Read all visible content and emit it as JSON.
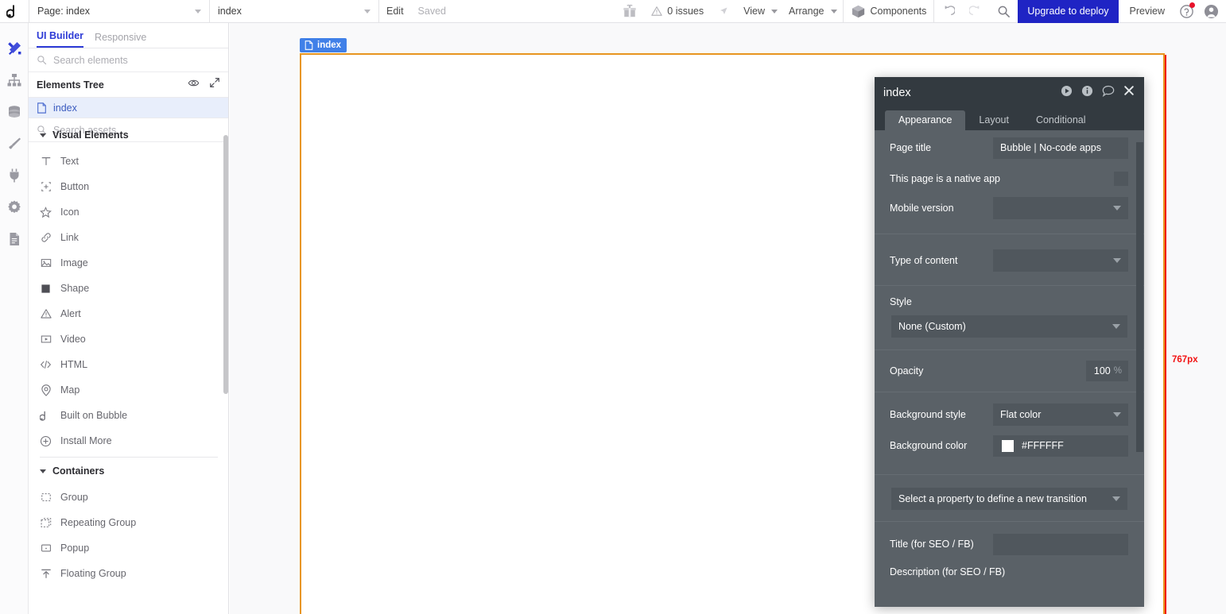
{
  "topbar": {
    "logo": "bubble-logo-icon",
    "page_selector": {
      "label": "Page: index",
      "icon": "chevron-down-icon"
    },
    "element_selector": {
      "label": "index",
      "icon": "chevron-down-icon"
    },
    "edit_label": "Edit",
    "saved_label": "Saved",
    "gift_icon": "gift-icon",
    "issues_label": "0 issues",
    "issues_icon": "warning-triangle-icon",
    "cursor_icon": "cursor-arrow-icon",
    "view_menu": "View",
    "arrange_menu": "Arrange",
    "components_label": "Components",
    "components_icon": "cube-icon",
    "undo_icon": "undo-icon",
    "redo_icon": "redo-icon",
    "search_icon": "search-icon",
    "upgrade_label": "Upgrade to deploy",
    "preview_label": "Preview",
    "help_icon": "question-circle-icon",
    "account_icon": "user-avatar-icon"
  },
  "rail": {
    "items": [
      {
        "name": "ui-builder",
        "icon": "design-tools-icon",
        "active": true
      },
      {
        "name": "workflow",
        "icon": "hierarchy-icon",
        "active": false
      },
      {
        "name": "data",
        "icon": "database-icon",
        "active": false
      },
      {
        "name": "styles",
        "icon": "paintbrush-icon",
        "active": false
      },
      {
        "name": "plugins",
        "icon": "plug-icon",
        "active": false
      },
      {
        "name": "settings",
        "icon": "gear-icon",
        "active": false
      },
      {
        "name": "logs",
        "icon": "document-icon",
        "active": false
      }
    ]
  },
  "left_panel": {
    "tabs": [
      {
        "label": "UI Builder",
        "active": true
      },
      {
        "label": "Responsive",
        "active": false
      }
    ],
    "search_elements_placeholder": "Search elements",
    "tree_header": {
      "title": "Elements Tree",
      "eye_icon": "eye-icon",
      "expand_icon": "expand-arrows-icon"
    },
    "tree_rows": [
      {
        "label": "index",
        "icon": "page-file-icon",
        "selected": true
      }
    ],
    "search_assets_placeholder": "Search assets",
    "sections": [
      {
        "title": "Visual Elements",
        "items": [
          {
            "label": "Text",
            "icon": "text-icon"
          },
          {
            "label": "Button",
            "icon": "button-icon"
          },
          {
            "label": "Icon",
            "icon": "star-icon"
          },
          {
            "label": "Link",
            "icon": "link-icon"
          },
          {
            "label": "Image",
            "icon": "image-icon"
          },
          {
            "label": "Shape",
            "icon": "shape-square-icon"
          },
          {
            "label": "Alert",
            "icon": "alert-triangle-icon"
          },
          {
            "label": "Video",
            "icon": "video-icon"
          },
          {
            "label": "HTML",
            "icon": "code-icon"
          },
          {
            "label": "Map",
            "icon": "map-pin-icon"
          },
          {
            "label": "Built on Bubble",
            "icon": "bubble-badge-icon"
          },
          {
            "label": "Install More",
            "icon": "plus-circle-icon"
          }
        ]
      },
      {
        "title": "Containers",
        "items": [
          {
            "label": "Group",
            "icon": "group-icon"
          },
          {
            "label": "Repeating Group",
            "icon": "repeating-group-icon"
          },
          {
            "label": "Popup",
            "icon": "popup-icon"
          },
          {
            "label": "Floating Group",
            "icon": "floating-group-icon"
          }
        ]
      }
    ]
  },
  "canvas": {
    "page_tab_label": "index",
    "page_tab_icon": "page-file-icon",
    "width_marker_label": "767px",
    "marker_color": "#f21313",
    "page_border_color": "#e8951f"
  },
  "property_panel": {
    "title": "index",
    "header_icons": [
      {
        "name": "play-icon"
      },
      {
        "name": "info-icon"
      },
      {
        "name": "comment-icon"
      },
      {
        "name": "close-icon"
      }
    ],
    "tabs": [
      {
        "label": "Appearance",
        "active": true
      },
      {
        "label": "Layout",
        "active": false
      },
      {
        "label": "Conditional",
        "active": false
      }
    ],
    "fields": {
      "page_title_label": "Page title",
      "page_title_value": "Bubble | No-code apps",
      "native_app_label": "This page is a native app",
      "native_app_checked": false,
      "mobile_version_label": "Mobile version",
      "mobile_version_value": "",
      "type_of_content_label": "Type of content",
      "type_of_content_value": "",
      "style_label": "Style",
      "style_value": "None (Custom)",
      "opacity_label": "Opacity",
      "opacity_value": "100",
      "opacity_unit": "%",
      "background_style_label": "Background style",
      "background_style_value": "Flat color",
      "background_color_label": "Background color",
      "background_color_value": "#FFFFFF",
      "transition_placeholder": "Select a property to define a new transition",
      "seo_title_label": "Title (for SEO / FB)",
      "seo_title_value": "",
      "seo_desc_label": "Description (for SEO / FB)"
    }
  }
}
